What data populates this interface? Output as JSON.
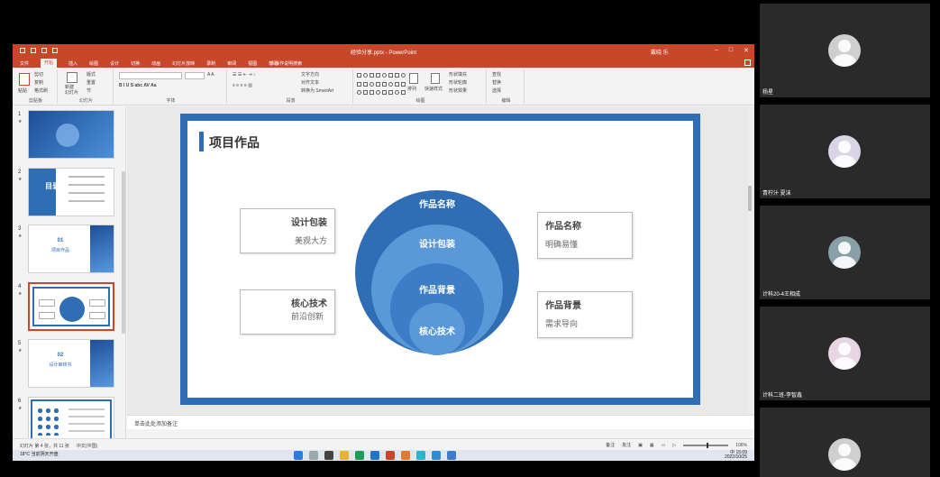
{
  "window": {
    "doc_title": "经验分享.pptx - PowerPoint",
    "user": "戴晓 乐"
  },
  "tabs": [
    "文件",
    "开始",
    "插入",
    "绘图",
    "设计",
    "切换",
    "动画",
    "幻灯片放映",
    "录制",
    "审阅",
    "视图",
    "帮助"
  ],
  "active_tab": "开始",
  "tell_me": "操作说明搜索",
  "ribbon": {
    "groups": [
      "剪贴板",
      "幻灯片",
      "字体",
      "段落",
      "绘图",
      "编辑"
    ],
    "paste": "粘贴",
    "cut": "剪切",
    "copy": "复制",
    "format_painter": "格式刷",
    "new_slide": "新建\n幻灯片",
    "layout": "版式",
    "reset": "重置",
    "section": "节",
    "text_direction": "文字方向",
    "align_text": "对齐文本",
    "smartart": "转换为 SmartArt",
    "arrange": "排列",
    "quick_styles": "快速样式",
    "shape_fill": "形状填充",
    "shape_outline": "形状轮廓",
    "shape_effects": "形状效果",
    "find": "查找",
    "replace": "替换",
    "select": "选择"
  },
  "thumbnails": [
    {
      "num": "1",
      "title": "",
      "caption": ""
    },
    {
      "num": "2",
      "title": "目录",
      "caption": ""
    },
    {
      "num": "3",
      "title": "01",
      "caption": "项目作品"
    },
    {
      "num": "4",
      "title": "",
      "caption": ""
    },
    {
      "num": "5",
      "title": "02",
      "caption": "设计审核书"
    },
    {
      "num": "6",
      "title": "",
      "caption": ""
    }
  ],
  "slide": {
    "title": "项目作品",
    "circles": [
      "作品名称",
      "设计包装",
      "作品背景",
      "核心技术"
    ],
    "callouts": {
      "left_top": {
        "heading": "设计包装",
        "text": "美观大方"
      },
      "left_bottom": {
        "heading": "核心技术",
        "text": "前沿创新"
      },
      "right_top": {
        "heading": "作品名称",
        "text": "明确易懂"
      },
      "right_bottom": {
        "heading": "作品背景",
        "text": "需求导向"
      }
    },
    "colors": {
      "dark": "#2f6db5",
      "mid": "#3d7cc7",
      "light": "#5b98d8",
      "inner": "#2d6cb4"
    }
  },
  "notes_placeholder": "单击此处添加备注",
  "status": {
    "slide_of": "幻灯片 第 4 张，共 11 张",
    "language": "中文(中国)",
    "notes": "备注",
    "comments": "批注",
    "zoom": "106%"
  },
  "taskbar": {
    "temp": "18°C",
    "weather": "当前阴天开盘",
    "time": "15:09",
    "date": "2022/10/25",
    "lang": "中"
  },
  "participants": [
    {
      "name": "杨星"
    },
    {
      "name": "青柠汁 夏沫"
    },
    {
      "name": "计科20-4王相成"
    },
    {
      "name": "计科二班-李智鑫"
    },
    {
      "name": ""
    }
  ]
}
